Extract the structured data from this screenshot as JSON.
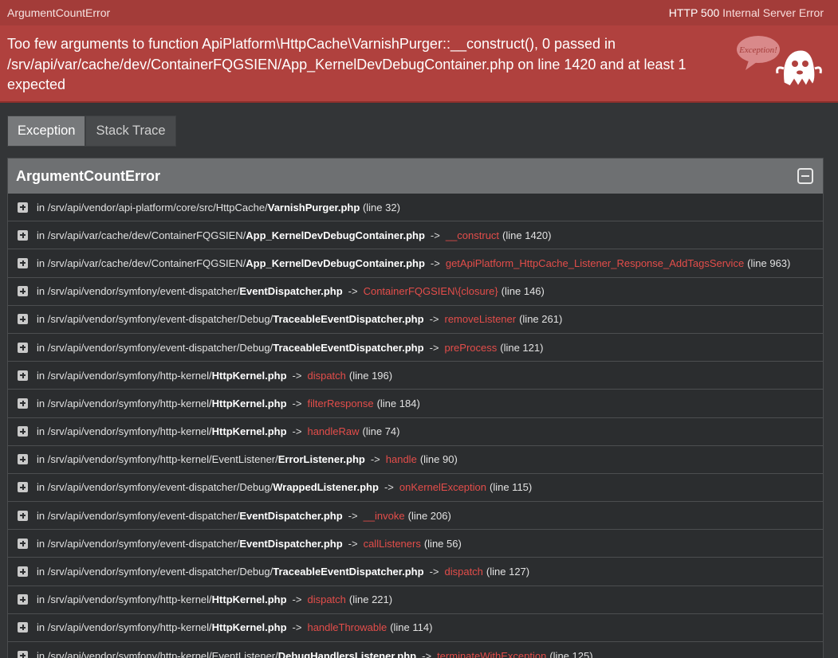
{
  "header": {
    "exception_class": "ArgumentCountError",
    "status_code": "HTTP 500",
    "status_text": "Internal Server Error",
    "message": "Too few arguments to function ApiPlatform\\HttpCache\\VarnishPurger::__construct(), 0 passed in /srv/api/var/cache/dev/ContainerFQGSIEN/App_KernelDevDebugContainer.php on line 1420 and at least 1 expected",
    "ghost_label": "Exception!"
  },
  "tabs": [
    {
      "label": "Exception",
      "active": true
    },
    {
      "label": "Stack Trace",
      "active": false
    }
  ],
  "panel": {
    "title": "ArgumentCountError"
  },
  "trace": [
    {
      "prefix": "in /srv/api/vendor/api-platform/core/src/HttpCache/",
      "file": "VarnishPurger.php",
      "func": "",
      "line": "(line 32)"
    },
    {
      "prefix": "in /srv/api/var/cache/dev/ContainerFQGSIEN/",
      "file": "App_KernelDevDebugContainer.php",
      "func": "__construct",
      "line": "(line 1420)"
    },
    {
      "prefix": "in /srv/api/var/cache/dev/ContainerFQGSIEN/",
      "file": "App_KernelDevDebugContainer.php",
      "func": "getApiPlatform_HttpCache_Listener_Response_AddTagsService",
      "line": "(line 963)"
    },
    {
      "prefix": "in /srv/api/vendor/symfony/event-dispatcher/",
      "file": "EventDispatcher.php",
      "func": "ContainerFQGSIEN\\{closure}",
      "line": "(line 146)"
    },
    {
      "prefix": "in /srv/api/vendor/symfony/event-dispatcher/Debug/",
      "file": "TraceableEventDispatcher.php",
      "func": "removeListener",
      "line": "(line 261)"
    },
    {
      "prefix": "in /srv/api/vendor/symfony/event-dispatcher/Debug/",
      "file": "TraceableEventDispatcher.php",
      "func": "preProcess",
      "line": "(line 121)"
    },
    {
      "prefix": "in /srv/api/vendor/symfony/http-kernel/",
      "file": "HttpKernel.php",
      "func": "dispatch",
      "line": "(line 196)"
    },
    {
      "prefix": "in /srv/api/vendor/symfony/http-kernel/",
      "file": "HttpKernel.php",
      "func": "filterResponse",
      "line": "(line 184)"
    },
    {
      "prefix": "in /srv/api/vendor/symfony/http-kernel/",
      "file": "HttpKernel.php",
      "func": "handleRaw",
      "line": "(line 74)"
    },
    {
      "prefix": "in /srv/api/vendor/symfony/http-kernel/EventListener/",
      "file": "ErrorListener.php",
      "func": "handle",
      "line": "(line 90)"
    },
    {
      "prefix": "in /srv/api/vendor/symfony/event-dispatcher/Debug/",
      "file": "WrappedListener.php",
      "func": "onKernelException",
      "line": "(line 115)"
    },
    {
      "prefix": "in /srv/api/vendor/symfony/event-dispatcher/",
      "file": "EventDispatcher.php",
      "func": "__invoke",
      "line": "(line 206)"
    },
    {
      "prefix": "in /srv/api/vendor/symfony/event-dispatcher/",
      "file": "EventDispatcher.php",
      "func": "callListeners",
      "line": "(line 56)"
    },
    {
      "prefix": "in /srv/api/vendor/symfony/event-dispatcher/Debug/",
      "file": "TraceableEventDispatcher.php",
      "func": "dispatch",
      "line": "(line 127)"
    },
    {
      "prefix": "in /srv/api/vendor/symfony/http-kernel/",
      "file": "HttpKernel.php",
      "func": "dispatch",
      "line": "(line 221)"
    },
    {
      "prefix": "in /srv/api/vendor/symfony/http-kernel/",
      "file": "HttpKernel.php",
      "func": "handleThrowable",
      "line": "(line 114)"
    },
    {
      "prefix": "in /srv/api/vendor/symfony/http-kernel/EventListener/",
      "file": "DebugHandlersListener.php",
      "func": "terminateWithException",
      "line": "(line 125)"
    }
  ],
  "colors": {
    "header_bg": "#b0413e",
    "page_bg": "#333537",
    "function_accent": "#e34d4a"
  }
}
